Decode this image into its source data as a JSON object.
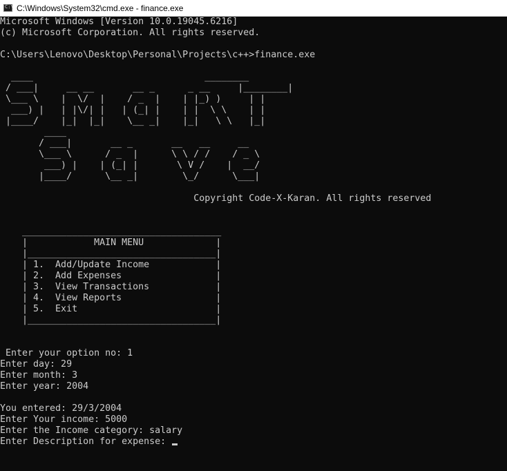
{
  "window": {
    "title": "C:\\Windows\\System32\\cmd.exe - finance.exe",
    "icon": "cmd-icon"
  },
  "console": {
    "lines": [
      "Microsoft Windows [Version 10.0.19045.6216]",
      "(c) Microsoft Corporation. All rights reserved.",
      "",
      "C:\\Users\\Lenovo\\Desktop\\Personal\\Projects\\c++>finance.exe",
      "",
      "  ____                               ________",
      " / ___|     __ __       __ _      _ __     |________|",
      " \\___ \\    |  \\/  |    / _  |    | |_) )     | |",
      "  ___) |   | |\\/| |   | (_| |    | |  \\ \\    | |",
      " |____/    |_|  |_|    \\__ _|    |_|   \\ \\   |_|",
      "        ____",
      "       / ___|       __ _       __   __     __",
      "       \\___ \\      / _  |      \\ \\ / /    / _ \\",
      "        ___) |    | (_| |       \\ V /    |  __/",
      "       |____/      \\__ _|        \\_/      \\___|",
      "",
      "                                   Copyright Code-X-Karan. All rights reserved",
      "",
      "",
      "    ____________________________________",
      "    |            MAIN MENU             |",
      "    |__________________________________|",
      "    | 1.  Add/Update Income            |",
      "    | 2.  Add Expenses                 |",
      "    | 3.  View Transactions            |",
      "    | 4.  View Reports                 |",
      "    | 5.  Exit                         |",
      "    |__________________________________|",
      "",
      "",
      " Enter your option no: 1",
      "Enter day: 29",
      "Enter month: 3",
      "Enter year: 2004",
      "",
      "You entered: 29/3/2004",
      "Enter Your income: 5000",
      "Enter the Income category: salary",
      "Enter Description for expense: "
    ]
  },
  "colors": {
    "background": "#0c0c0c",
    "text": "#cccccc",
    "titlebar": "#ffffff"
  }
}
